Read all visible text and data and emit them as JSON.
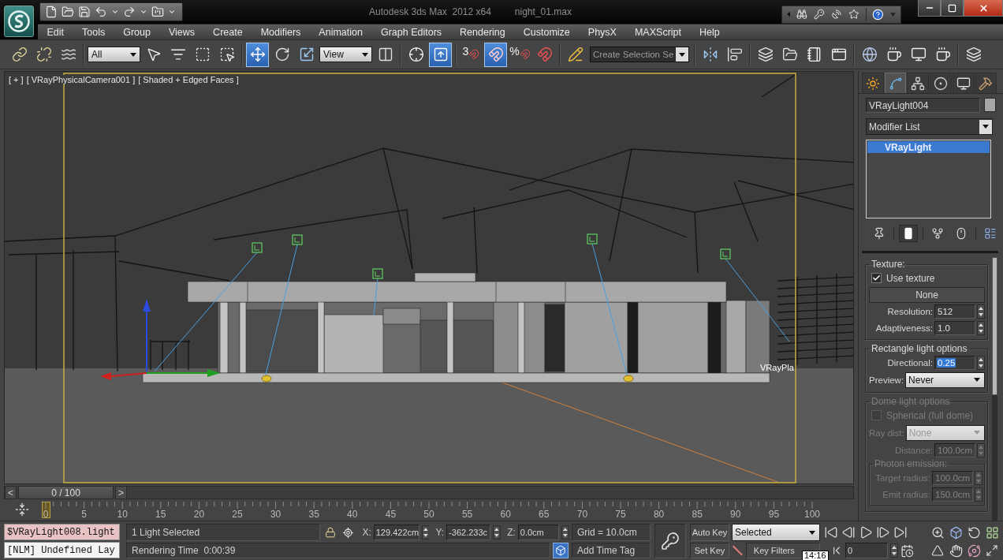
{
  "title_bar": {
    "app_title": "Autodesk 3ds Max  2012 x64",
    "file_name": "night_01.max"
  },
  "menu": [
    "Edit",
    "Tools",
    "Group",
    "Views",
    "Create",
    "Modifiers",
    "Animation",
    "Graph Editors",
    "Rendering",
    "Customize",
    "PhysX",
    "MAXScript",
    "Help"
  ],
  "main_toolbar": [
    [
      {
        "kind": "link",
        "selected": false
      },
      {
        "kind": "unlink",
        "selected": false
      },
      {
        "kind": "bind",
        "selected": false
      }
    ],
    [
      {
        "kind": "filter_dropdown",
        "value": "All"
      },
      {
        "kind": "select",
        "selected": false
      },
      {
        "kind": "select_by_name",
        "selected": false
      },
      {
        "kind": "region",
        "selected": false
      },
      {
        "kind": "crossing",
        "selected": false
      }
    ],
    [
      {
        "kind": "move",
        "selected": true
      },
      {
        "kind": "rotate",
        "selected": false
      },
      {
        "kind": "scale",
        "selected": false
      },
      {
        "kind": "coordinate_dropdown",
        "value": "View"
      },
      {
        "kind": "pivot",
        "selected": false
      }
    ],
    [
      {
        "kind": "manipulate",
        "selected": false
      },
      {
        "kind": "shortcut_override",
        "selected": true
      }
    ],
    [
      {
        "kind": "snap",
        "label": "3",
        "selected": false
      },
      {
        "kind": "angle_snap",
        "selected": true
      },
      {
        "kind": "percent_snap",
        "label": "%",
        "selected": false
      },
      {
        "kind": "spinner_snap",
        "selected": false
      }
    ],
    [
      {
        "kind": "named_edit",
        "selected": false
      },
      {
        "kind": "named_selection",
        "value": "Create Selection Se"
      }
    ],
    [
      {
        "kind": "mirror",
        "selected": false
      },
      {
        "kind": "align",
        "selected": false
      }
    ],
    [
      {
        "kind": "layers",
        "selected": false
      },
      {
        "kind": "explorer",
        "selected": false
      },
      {
        "kind": "curve_editor",
        "selected": false
      },
      {
        "kind": "schematic",
        "selected": false
      }
    ],
    [
      {
        "kind": "material",
        "selected": false
      },
      {
        "kind": "render_setup",
        "selected": false
      },
      {
        "kind": "frame_window",
        "selected": false
      },
      {
        "kind": "render",
        "selected": false
      }
    ],
    [
      {
        "kind": "more",
        "selected": false
      }
    ]
  ],
  "viewport": {
    "labels": [
      "[ + ]",
      "[ VRayPhysicalCamera001 ]",
      "[ Shaded + Edged Faces ]"
    ],
    "object_label": "VRayPla"
  },
  "time_slider": {
    "prev": "<",
    "counter": "0 / 100",
    "next": ">",
    "level": 0
  },
  "trackbar": {
    "labels": [
      "0",
      "5",
      "10",
      "15",
      "20",
      "25",
      "30",
      "35",
      "40",
      "45",
      "50",
      "55",
      "60",
      "65",
      "70",
      "75",
      "80",
      "85",
      "90",
      "95",
      "100"
    ]
  },
  "command_panel": {
    "tabs": [
      {
        "kind": "create",
        "selected": false
      },
      {
        "kind": "modify",
        "selected": true
      },
      {
        "kind": "hierarchy",
        "selected": false
      },
      {
        "kind": "motion",
        "selected": false
      },
      {
        "kind": "display",
        "selected": false
      },
      {
        "kind": "utilities",
        "selected": false
      }
    ],
    "object_name": "VRayLight004",
    "modifier_list": "Modifier List",
    "stack": [
      {
        "label": "VRayLight",
        "selected": true
      }
    ],
    "stack_buttons": [
      {
        "kind": "pin",
        "selected": false
      },
      {
        "kind": "end_result",
        "selected": true
      },
      {
        "kind": "unique",
        "selected": false
      },
      {
        "kind": "remove",
        "selected": false
      },
      {
        "kind": "configure",
        "selected": false
      }
    ],
    "groups": [
      {
        "title": "Texture:",
        "disabled": false,
        "rows": [
          {
            "kind": "checkbox",
            "label": "Use texture",
            "checked": true
          },
          {
            "kind": "button",
            "label": "None"
          },
          {
            "kind": "spinner",
            "label": "Resolution:",
            "value": "512",
            "highlighted": false
          },
          {
            "kind": "spinner",
            "label": "Adaptiveness:",
            "value": "1.0",
            "highlighted": false
          }
        ]
      },
      {
        "title": "Rectangle light options",
        "disabled": false,
        "rows": [
          {
            "kind": "spinner",
            "label": "Directional:",
            "value": "0.25",
            "highlighted": true
          },
          {
            "kind": "dropdown",
            "label": "Preview:",
            "value": "Never"
          }
        ]
      },
      {
        "title": "Dome light options",
        "disabled": true,
        "rows": [
          {
            "kind": "checkbox",
            "label": "Spherical (full dome)",
            "checked": false
          },
          {
            "kind": "dropdown",
            "label": "Ray dist:",
            "value": "None"
          },
          {
            "kind": "spinner",
            "label": "Distance:",
            "value": "100.0cm",
            "highlighted": false
          },
          {
            "kind": "group",
            "title": "Photon emission:",
            "rows": [
              {
                "kind": "spinner",
                "label": "Target radius:",
                "value": "100.0cm",
                "highlighted": false
              },
              {
                "kind": "spinner",
                "label": "Emit radius:",
                "value": "150.0cm",
                "highlighted": false
              }
            ]
          }
        ]
      }
    ]
  },
  "status_bar": {
    "listener_input": "$VRayLight008.light",
    "listener_output": "[NLM] Undefined Lay",
    "selection_status": "1 Light Selected",
    "prompt": "Rendering Time  0:00:39",
    "coordinates": [
      {
        "axis": "X:",
        "value": "129.422cm"
      },
      {
        "axis": "Y:",
        "value": "-362.233c"
      },
      {
        "axis": "Z:",
        "value": "0.0cm"
      }
    ],
    "grid": "Grid = 10.0cm",
    "time_tag": "Add Time Tag",
    "auto_key": {
      "label": "Auto Key",
      "on": false
    },
    "key_filter": "Selected",
    "set_key": "Set Key",
    "key_filters": "Key Filters",
    "frame": "0"
  },
  "clock": "14:16"
}
